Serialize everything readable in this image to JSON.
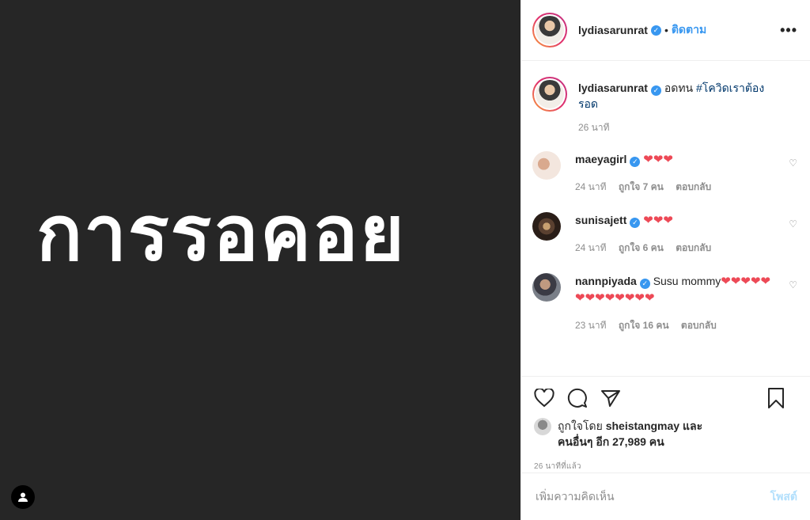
{
  "media": {
    "text": "การรอคอย"
  },
  "header": {
    "username": "lydiasarunrat",
    "separator": "•",
    "follow_label": "ติดตาม",
    "more_label": "•••"
  },
  "caption": {
    "username": "lydiasarunrat",
    "text": "อดทน",
    "hashtag": "#โควิดเราต้องรอด",
    "time": "26 นาที"
  },
  "comments": [
    {
      "username": "maeyagirl",
      "text": "",
      "hearts": "❤❤❤",
      "time": "24 นาที",
      "likes": "ถูกใจ 7 คน",
      "reply": "ตอบกลับ"
    },
    {
      "username": "sunisajett",
      "text": "",
      "hearts": "❤❤❤",
      "time": "24 นาที",
      "likes": "ถูกใจ 6 คน",
      "reply": "ตอบกลับ"
    },
    {
      "username": "nannpiyada",
      "text": "Susu mommy",
      "hearts": "❤❤❤❤❤❤❤❤❤❤❤❤❤",
      "time": "23 นาที",
      "likes": "ถูกใจ 16 คน",
      "reply": "ตอบกลับ"
    }
  ],
  "likes_summary": {
    "prefix": "ถูกใจโดย",
    "user": "sheistangmay",
    "middle": "และ",
    "others": "คนอื่นๆ อีก 27,989 คน"
  },
  "post_time": "26 นาทีที่แล้ว",
  "add_comment": {
    "placeholder": "เพิ่มความคิดเห็น",
    "post_label": "โพสต์"
  },
  "colors": {
    "accent": "#3897f0",
    "heart": "#ed4956",
    "media_bg": "#262626"
  }
}
